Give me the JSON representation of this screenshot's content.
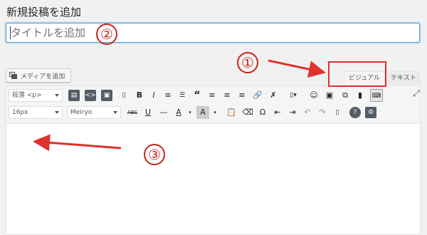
{
  "page": {
    "title": "新規投稿を追加"
  },
  "title_field": {
    "placeholder": "タイトルを追加"
  },
  "media": {
    "label": "メディアを追加"
  },
  "editor_tabs": {
    "visual": "ビジュアル",
    "text": "テキスト"
  },
  "toolbar": {
    "format_select": "段落 <p>",
    "fontsize_select": "16px",
    "font_select": "Meiryo",
    "row1_glyphs": {
      "bold": "B",
      "italic": "I",
      "quote": "“",
      "more": "☺"
    },
    "row2_glyphs": {
      "strike": "ABC",
      "underline": "U",
      "hr": "—",
      "textcolor": "A",
      "bgcolor": "A",
      "omega": "Ω",
      "help": "?"
    }
  },
  "annotations": {
    "one": "①",
    "two": "②",
    "three": "③"
  },
  "colors": {
    "annotation_red": "#e0312c",
    "accent": "#5b9dd9"
  }
}
